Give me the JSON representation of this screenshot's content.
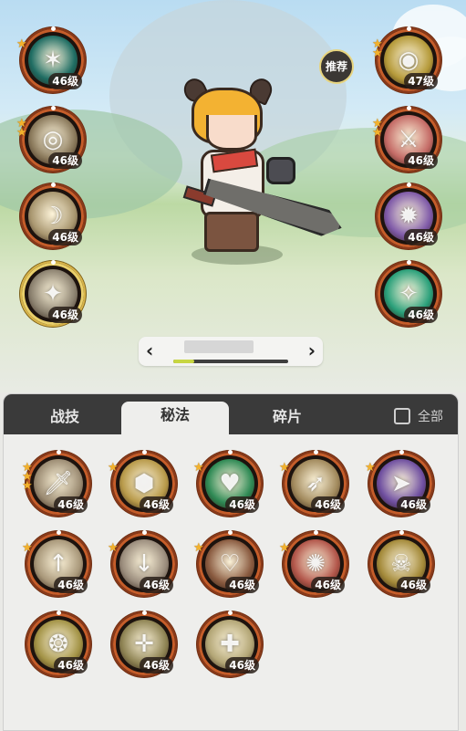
{
  "recommend_label": "推荐",
  "left_skills": [
    {
      "name": "web-skill-icon",
      "level": "46级",
      "stars": 1,
      "glyph": "✶",
      "bg": "#1f6d63"
    },
    {
      "name": "whirl-skill-icon",
      "level": "46级",
      "stars": 2,
      "glyph": "◎",
      "bg": "#8b7a5c"
    },
    {
      "name": "slash-skill-icon",
      "level": "46级",
      "stars": 0,
      "glyph": "☽",
      "bg": "#a99770"
    },
    {
      "name": "burst-skill-icon",
      "level": "46级",
      "stars": 0,
      "glyph": "✦",
      "bg": "#8c8270"
    }
  ],
  "right_skills": [
    {
      "name": "eye-skill-icon",
      "level": "47级",
      "stars": 2,
      "glyph": "◉",
      "bg": "#b59a3a"
    },
    {
      "name": "blade-skill-icon",
      "level": "46级",
      "stars": 2,
      "glyph": "⚔",
      "bg": "#c46b66"
    },
    {
      "name": "arcane-skill-icon",
      "level": "46级",
      "stars": 0,
      "glyph": "✹",
      "bg": "#7f5aa8"
    },
    {
      "name": "wind-skill-icon",
      "level": "46级",
      "stars": 0,
      "glyph": "✧",
      "bg": "#2aa07a"
    }
  ],
  "pager": {
    "progress": 0.18
  },
  "tabs": [
    "战技",
    "秘法",
    "碎片"
  ],
  "active_tab": 1,
  "select_all_label": "全部",
  "grid_skills": [
    {
      "name": "dagger-skill-icon",
      "level": "46级",
      "stars": 3,
      "glyph": "🗡",
      "bg": "#9d8d74"
    },
    {
      "name": "shield-skill-icon",
      "level": "46级",
      "stars": 1,
      "glyph": "⬢",
      "bg": "#b89a4a"
    },
    {
      "name": "heart-heal-skill-icon",
      "level": "46级",
      "stars": 1,
      "glyph": "♥",
      "bg": "#2f8a55"
    },
    {
      "name": "boot-skill-icon",
      "level": "46级",
      "stars": 1,
      "glyph": "➶",
      "bg": "#a28a5d"
    },
    {
      "name": "dash-skill-icon",
      "level": "46级",
      "stars": 1,
      "glyph": "➤",
      "bg": "#6f4fa0"
    },
    {
      "name": "sword-up-skill-icon",
      "level": "46级",
      "stars": 1,
      "glyph": "↑",
      "bg": "#a9987a"
    },
    {
      "name": "sword-down-skill-icon",
      "level": "46级",
      "stars": 1,
      "glyph": "↓",
      "bg": "#9b8d7d"
    },
    {
      "name": "heart-shield-skill-icon",
      "level": "46级",
      "stars": 1,
      "glyph": "♡",
      "bg": "#8a5b40"
    },
    {
      "name": "rage-skill-icon",
      "level": "46级",
      "stars": 1,
      "glyph": "✺",
      "bg": "#b2564a"
    },
    {
      "name": "skull-skill-icon",
      "level": "46级",
      "stars": 0,
      "glyph": "☠",
      "bg": "#a48a3a"
    },
    {
      "name": "aura-skill-icon",
      "level": "46级",
      "stars": 0,
      "glyph": "❂",
      "bg": "#a39346"
    },
    {
      "name": "crosshair-skill-icon",
      "level": "46级",
      "stars": 0,
      "glyph": "✛",
      "bg": "#8f8454"
    },
    {
      "name": "summon-skill-icon",
      "level": "46级",
      "stars": 0,
      "glyph": "✚",
      "bg": "#b3a676"
    }
  ]
}
